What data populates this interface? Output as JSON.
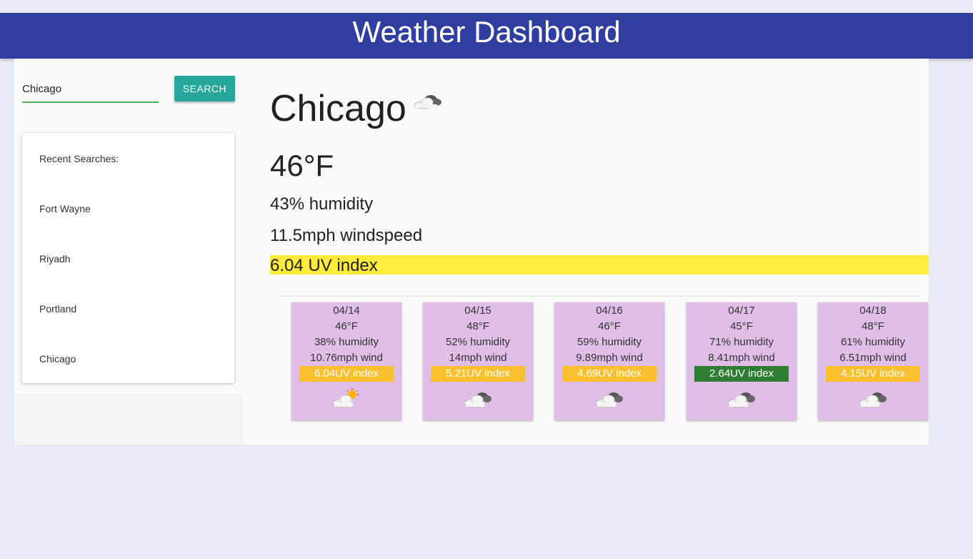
{
  "header": {
    "title": "Weather Dashboard"
  },
  "search": {
    "value": "Chicago",
    "button_label": "SEARCH"
  },
  "recent": {
    "title": "Recent Searches:",
    "items": [
      "Fort Wayne",
      "Riyadh",
      "Portland",
      "Chicago"
    ]
  },
  "current": {
    "city": "Chicago",
    "icon": "partly-cloudy-icon",
    "temperature": "46°F",
    "humidity": "43% humidity",
    "windspeed": "11.5mph windspeed",
    "uv": "6.04 UV index",
    "uv_color": "#ffeb3b"
  },
  "forecast": [
    {
      "date": "04/14",
      "temp": "46°F",
      "humidity": "38% humidity",
      "wind": "10.76mph wind",
      "uv": "6.04UV index",
      "uv_color": "#fbc02d",
      "icon": "sun-behind-cloud-icon"
    },
    {
      "date": "04/15",
      "temp": "48°F",
      "humidity": "52% humidity",
      "wind": "14mph wind",
      "uv": "5.21UV index",
      "uv_color": "#fbc02d",
      "icon": "cloudy-icon"
    },
    {
      "date": "04/16",
      "temp": "46°F",
      "humidity": "59% humidity",
      "wind": "9.89mph wind",
      "uv": "4.69UV index",
      "uv_color": "#fbc02d",
      "icon": "cloudy-icon"
    },
    {
      "date": "04/17",
      "temp": "45°F",
      "humidity": "71% humidity",
      "wind": "8.41mph wind",
      "uv": "2.64UV index",
      "uv_color": "#2e7d32",
      "icon": "cloudy-icon"
    },
    {
      "date": "04/18",
      "temp": "48°F",
      "humidity": "61% humidity",
      "wind": "6.51mph wind",
      "uv": "4.15UV index",
      "uv_color": "#fbc02d",
      "icon": "cloudy-icon"
    }
  ]
}
